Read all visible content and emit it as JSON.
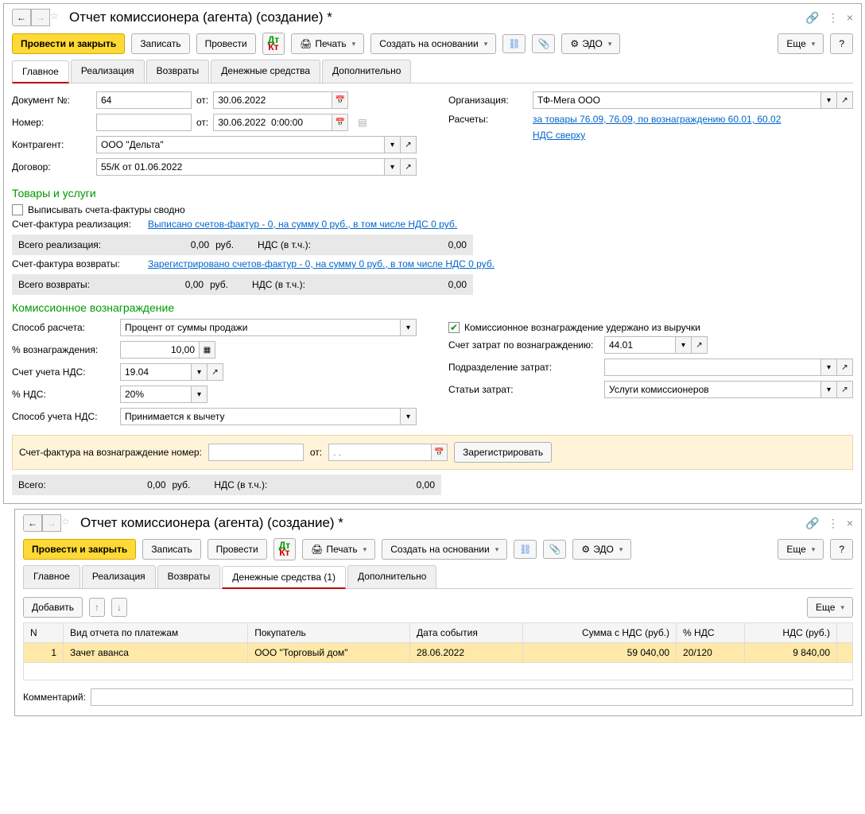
{
  "window1": {
    "title": "Отчет комиссионера (агента) (создание) *",
    "toolbar": {
      "submit": "Провести и закрыть",
      "save": "Записать",
      "post": "Провести",
      "print": "Печать",
      "create_based": "Создать на основании",
      "edo": "ЭДО",
      "more": "Еще",
      "help": "?"
    },
    "tabs": {
      "main": "Главное",
      "realization": "Реализация",
      "returns": "Возвраты",
      "cash": "Денежные средства",
      "additional": "Дополнительно"
    },
    "fields": {
      "doc_no_label": "Документ №:",
      "doc_no": "64",
      "from_label": "от:",
      "date1": "30.06.2022",
      "number_label": "Номер:",
      "date2": "30.06.2022  0:00:00",
      "counterparty_label": "Контрагент:",
      "counterparty": "ООО \"Дельта\"",
      "contract_label": "Договор:",
      "contract": "55/К от 01.06.2022",
      "org_label": "Организация:",
      "org": "ТФ-Мега ООО",
      "calc_label": "Расчеты:",
      "calc_link": "за товары 76.09, 76.09, по вознаграждению 60.01, 60.02",
      "vat_link": "НДС сверху"
    },
    "goods_section": {
      "title": "Товары и услуги",
      "checkbox": "Выписывать счета-фактуры сводно",
      "invoice_realization_label": "Счет-фактура реализация:",
      "invoice_realization_link": "Выписано счетов-фактур - 0, на сумму 0 руб., в том числе НДС 0 руб.",
      "total_realization": "Всего реализация:",
      "amount_zero": "0,00",
      "rub": "руб.",
      "vat_incl": "НДС (в т.ч.):",
      "invoice_returns_label": "Счет-фактура возвраты:",
      "invoice_returns_link": "Зарегистрировано счетов-фактур - 0, на сумму 0 руб., в том числе НДС 0 руб.",
      "total_returns": "Всего возвраты:"
    },
    "commission": {
      "title": "Комиссионное вознаграждение",
      "method_label": "Способ расчета:",
      "method": "Процент от суммы продажи",
      "checkbox": "Комиссионное вознаграждение удержано из выручки",
      "percent_label": "% вознаграждения:",
      "percent": "10,00",
      "vat_account_label": "Счет учета НДС:",
      "vat_account": "19.04",
      "vat_percent_label": "% НДС:",
      "vat_percent": "20%",
      "vat_method_label": "Способ учета НДС:",
      "vat_method": "Принимается к вычету",
      "cost_account_label": "Счет затрат по вознаграждению:",
      "cost_account": "44.01",
      "dept_label": "Подразделение затрат:",
      "articles_label": "Статьи затрат:",
      "articles": "Услуги комиссионеров",
      "invoice_no_label": "Счет-фактура на вознаграждение номер:",
      "from": "от:",
      "date_placeholder": ". .",
      "register": "Зарегистрировать",
      "total": "Всего:"
    }
  },
  "window2": {
    "title": "Отчет комиссионера (агента) (создание) *",
    "tabs": {
      "main": "Главное",
      "realization": "Реализация",
      "returns": "Возвраты",
      "cash": "Денежные средства (1)",
      "additional": "Дополнительно"
    },
    "toolbar2": {
      "add": "Добавить",
      "more": "Еще"
    },
    "table": {
      "headers": {
        "n": "N",
        "type": "Вид отчета по платежам",
        "buyer": "Покупатель",
        "date": "Дата события",
        "sum": "Сумма с НДС (руб.)",
        "vat_pct": "% НДС",
        "vat": "НДС (руб.)"
      },
      "row1": {
        "n": "1",
        "type": "Зачет аванса",
        "buyer": "ООО \"Торговый дом\"",
        "date": "28.06.2022",
        "sum": "59 040,00",
        "vat_pct": "20/120",
        "vat": "9 840,00"
      }
    },
    "comment_label": "Комментарий:"
  }
}
